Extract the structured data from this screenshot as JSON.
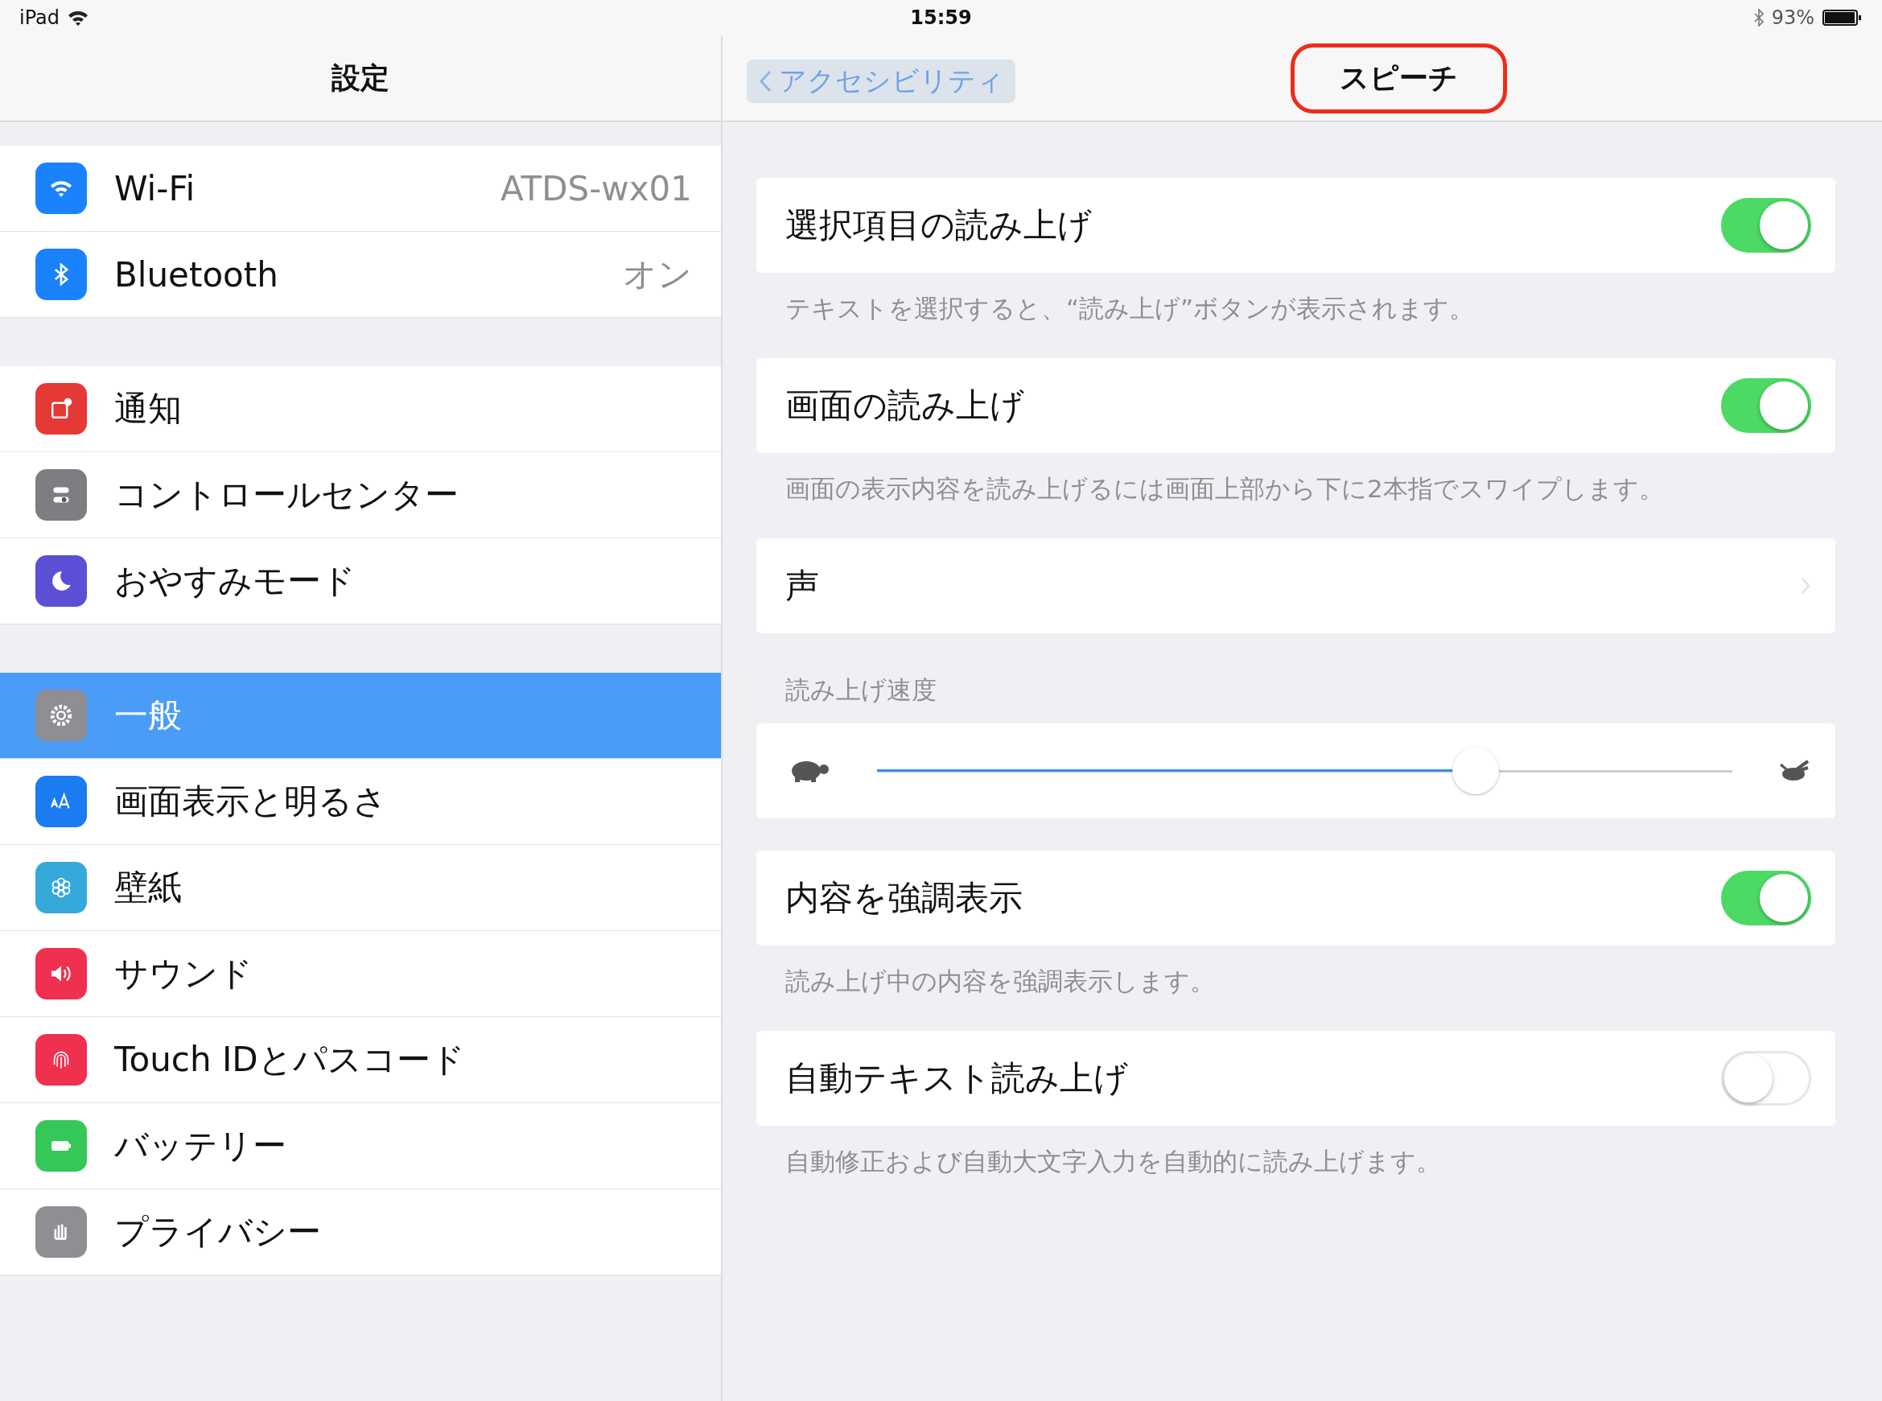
{
  "status_bar": {
    "carrier": "iPad",
    "time": "15:59",
    "battery": "93%"
  },
  "sidebar": {
    "title": "設定",
    "groups": [
      {
        "items": [
          {
            "kind": "wifi",
            "color": "#1a82fb",
            "label": "Wi-Fi",
            "value": "ATDS-wx01",
            "selected": false
          },
          {
            "kind": "bluetooth",
            "color": "#1a82fb",
            "label": "Bluetooth",
            "value": "オン",
            "selected": false
          }
        ]
      },
      {
        "items": [
          {
            "kind": "notifications",
            "color": "#e53935",
            "label": "通知",
            "selected": false
          },
          {
            "kind": "control",
            "color": "#7d7d82",
            "label": "コントロールセンター",
            "selected": false
          },
          {
            "kind": "moon",
            "color": "#5b4fd6",
            "label": "おやすみモード",
            "selected": false
          }
        ]
      },
      {
        "items": [
          {
            "kind": "gear",
            "color": "#8e8e93",
            "label": "一般",
            "selected": true
          },
          {
            "kind": "text-size",
            "color": "#1a7cf0",
            "label": "画面表示と明るさ",
            "selected": false
          },
          {
            "kind": "flower",
            "color": "#35a9d9",
            "label": "壁紙",
            "selected": false
          },
          {
            "kind": "speaker",
            "color": "#f0304f",
            "label": "サウンド",
            "selected": false
          },
          {
            "kind": "fingerprint",
            "color": "#f0304f",
            "label": "Touch IDとパスコード",
            "selected": false
          },
          {
            "kind": "battery",
            "color": "#36c759",
            "label": "バッテリー",
            "selected": false
          },
          {
            "kind": "hand",
            "color": "#8e8e93",
            "label": "プライバシー",
            "selected": false
          }
        ]
      }
    ]
  },
  "detail": {
    "back_label": "アクセシビリティ",
    "title": "スピーチ",
    "title_circled": true,
    "sections": [
      {
        "kind": "toggle",
        "label": "選択項目の読み上げ",
        "on": true,
        "footer": "テキストを選択すると、“読み上げ”ボタンが表示されます。"
      },
      {
        "kind": "toggle",
        "label": "画面の読み上げ",
        "on": true,
        "footer": "画面の表示内容を読み上げるには画面上部から下に2本指でスワイプします。"
      },
      {
        "kind": "link",
        "label": "声"
      },
      {
        "kind": "slider",
        "header": "読み上げ速度",
        "level": 0.7
      },
      {
        "kind": "toggle",
        "label": "内容を強調表示",
        "on": true,
        "footer": "読み上げ中の内容を強調表示します。"
      },
      {
        "kind": "toggle",
        "label": "自動テキスト読み上げ",
        "on": false,
        "footer": "自動修正および自動大文字入力を自動的に読み上げます。"
      }
    ]
  }
}
